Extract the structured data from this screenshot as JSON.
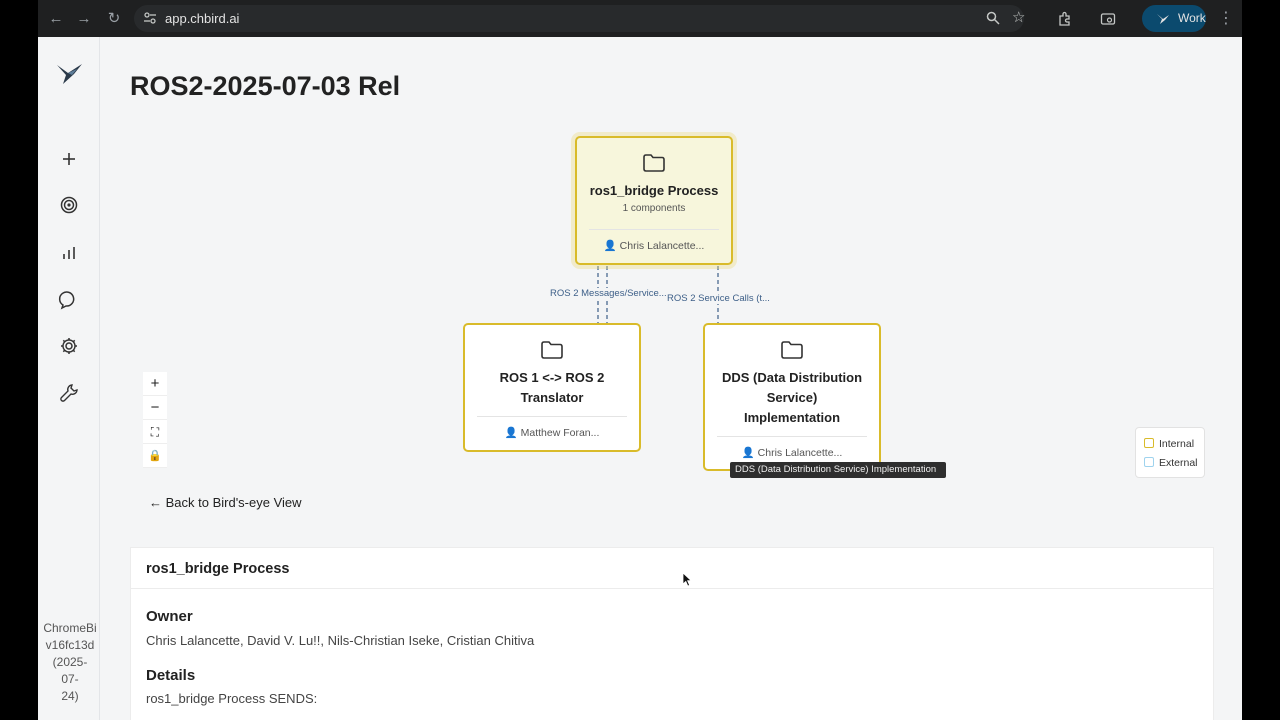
{
  "browser": {
    "url": "app.chbird.ai",
    "profile_label": "Work"
  },
  "sidebar": {
    "items": [
      {
        "name": "add-icon"
      },
      {
        "name": "target-icon"
      },
      {
        "name": "chart-icon"
      },
      {
        "name": "chat-icon"
      },
      {
        "name": "gear-icon"
      },
      {
        "name": "wrench-icon"
      }
    ],
    "build_lines": [
      "ChromeBi",
      "v16fc13d",
      "(2025-",
      "07-",
      "24)"
    ]
  },
  "page": {
    "title": "ROS2-2025-07-03 Rel"
  },
  "graph": {
    "nodes": [
      {
        "title": "ros1_bridge Process",
        "subtitle": "1 components",
        "owner": "Chris Lalancette..."
      },
      {
        "title_lines": [
          "ROS 1 <-> ROS 2",
          "Translator"
        ],
        "owner": "Matthew Foran..."
      },
      {
        "title_lines": [
          "DDS (Data Distribution",
          "Service)",
          "Implementation"
        ],
        "owner": "Chris Lalancette..."
      }
    ],
    "edges": [
      {
        "label": "ROS 2 Messages/Service..."
      },
      {
        "label": "ROS 2 Service Calls (t..."
      }
    ],
    "tooltip": "DDS (Data Distribution Service) Implementation",
    "colors": {
      "internal": "#d9bb2a",
      "external": "#9fd3ee",
      "edge": "#3d5f88"
    }
  },
  "zoom_controls": {
    "zoom_in": "+",
    "zoom_out": "−",
    "fit": "⛶",
    "lock": "🔒"
  },
  "legend": {
    "internal": "Internal",
    "external": "External"
  },
  "back_link": "← Back to Bird's-eye View",
  "detail": {
    "title": "ros1_bridge Process",
    "owner_heading": "Owner",
    "owners": "Chris Lalancette, David V. Lu!!, Nils-Christian Iseke, Cristian Chitiva",
    "details_heading": "Details",
    "details_text": "ros1_bridge Process SENDS:"
  }
}
